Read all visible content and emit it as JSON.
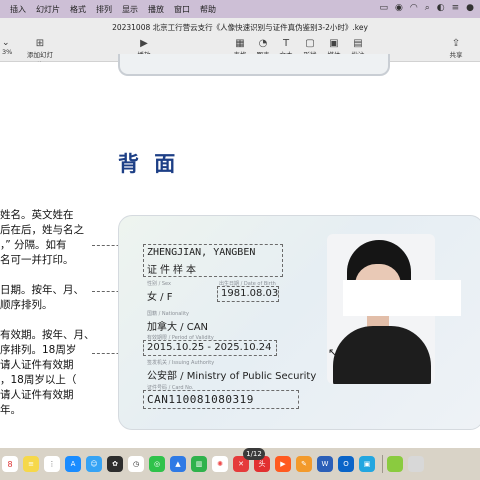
{
  "menubar": {
    "items": [
      "插入",
      "幻灯片",
      "格式",
      "排列",
      "显示",
      "播放",
      "窗口",
      "帮助"
    ],
    "status_icons": [
      "display-icon",
      "control-icon",
      "wifi-icon",
      "search-icon",
      "account-icon",
      "control-center-icon",
      "siri-icon"
    ]
  },
  "toolbar": {
    "doc_title": "20231008 北京工行营云支行《人像快速识别与证件真伪鉴别3-2小时》.key",
    "zoom": "3%",
    "add_slide": "添加幻灯片",
    "play": "播放",
    "table": "表格",
    "chart": "图表",
    "text": "文本",
    "shape": "形状",
    "media": "媒体",
    "comment": "批注",
    "share": "共享"
  },
  "slide": {
    "heading": "背 面",
    "side_lines": [
      "姓名。英文姓在",
      "后在后，姓与名之",
      "，” 分隔。如有",
      "名可一并打印。",
      "",
      "日期。按年、月、",
      "顺序排列。",
      "",
      "有效期。按年、月、",
      "序排列。18周岁",
      "请人证件有效期",
      "，18周岁以上（",
      "请人证件有效期",
      "年。"
    ]
  },
  "card": {
    "name_en": "ZHENGJIAN, YANGBEN",
    "name_cn": "证件样本",
    "sex_tag": "性别 / Sex",
    "sex": "女 / F",
    "dob_tag": "出生日期 / Date of Birth",
    "dob": "1981.08.03",
    "nationality_tag": "国籍 / Nationality",
    "nationality": "加拿大 / CAN",
    "validity_tag": "有效期限 / Period of Validity",
    "validity": "2015.10.25 - 2025.10.24",
    "authority_tag": "签发机关 / Issuing Authority",
    "authority": "公安部 / Ministry of Public Security",
    "card_no_tag": "证件号码 / Card No.",
    "card_no": "CAN110081080319"
  },
  "dock": {
    "page_indicator": "1/12",
    "icons": [
      "calendar-icon",
      "notes-icon",
      "reminders-icon",
      "app-store-icon",
      "finder-icon",
      "chatgpt-icon",
      "clock-icon",
      "wechat-icon",
      "keynote-icon",
      "numbers-icon",
      "photos-icon",
      "xmind-icon",
      "toutiao-icon",
      "kwai-icon",
      "pages-icon",
      "word-icon",
      "outlook-icon",
      "bilibili-icon",
      "app-icon",
      "app-icon"
    ]
  }
}
